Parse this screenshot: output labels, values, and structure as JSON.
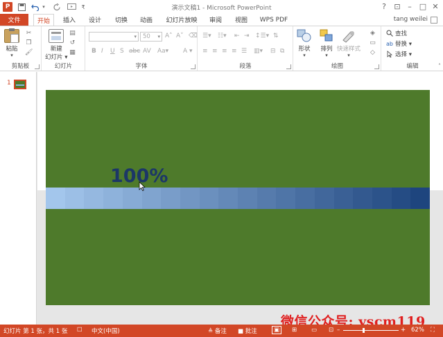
{
  "titlebar": {
    "app_logo": "P",
    "title": "演示文稿1 - Microsoft PowerPoint",
    "help": "?",
    "restore_ribbon": "⊡",
    "minimize": "–",
    "maximize": "□",
    "close": "✕"
  },
  "tabs": {
    "file": "文件",
    "items": [
      "开始",
      "插入",
      "设计",
      "切换",
      "动画",
      "幻灯片放映",
      "审阅",
      "视图",
      "WPS PDF"
    ],
    "active_index": 0,
    "user": "tang weilei"
  },
  "ribbon": {
    "clipboard": {
      "label": "剪贴板",
      "paste": "粘贴"
    },
    "slides": {
      "label": "幻灯片",
      "new_slide_1": "新建",
      "new_slide_2": "幻灯片 ▾"
    },
    "font": {
      "label": "字体",
      "font_size": "50"
    },
    "paragraph": {
      "label": "段落"
    },
    "drawing": {
      "label": "绘图",
      "shapes": "形状",
      "arrange": "排列",
      "quick_styles": "快速样式"
    },
    "editing": {
      "label": "编辑",
      "find": "查找",
      "replace": "替换 ▾",
      "select": "选择 ▾"
    }
  },
  "thumbnails": {
    "number": "1"
  },
  "slide": {
    "percent_text": "100%",
    "progress": 1.0,
    "background": "#4e7a2b"
  },
  "statusbar": {
    "slide_info": "幻灯片 第 1 张，共 1 张",
    "language": "中文(中国)",
    "notes": "备注",
    "comments": "批注",
    "zoom": "62%"
  },
  "watermark": "微信公众号: yscm119",
  "colors": {
    "accent": "#d24726",
    "slide_green": "#4e7a2b",
    "text_dark_blue": "#1c3767"
  }
}
